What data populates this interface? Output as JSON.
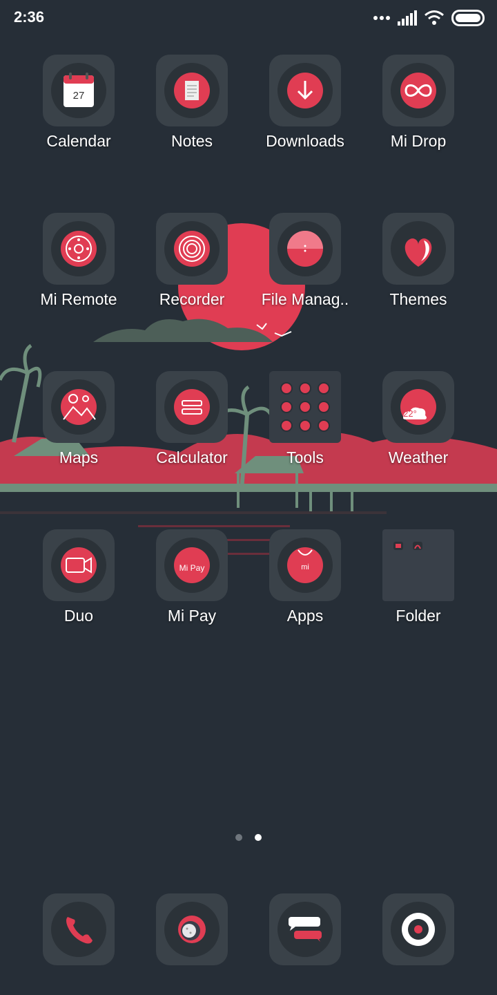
{
  "status_bar": {
    "time": "2:36"
  },
  "apps": [
    {
      "label": "Calendar",
      "icon": "calendar-icon",
      "calendar_day": "27"
    },
    {
      "label": "Notes",
      "icon": "notes-icon"
    },
    {
      "label": "Downloads",
      "icon": "download-icon"
    },
    {
      "label": "Mi Drop",
      "icon": "infinity-icon"
    },
    {
      "label": "Mi Remote",
      "icon": "remote-icon"
    },
    {
      "label": "Recorder",
      "icon": "record-icon"
    },
    {
      "label": "File Manag..",
      "icon": "folder-icon"
    },
    {
      "label": "Themes",
      "icon": "themes-icon"
    },
    {
      "label": "Maps",
      "icon": "map-icon"
    },
    {
      "label": "Calculator",
      "icon": "calculator-icon"
    },
    {
      "label": "Tools",
      "icon": "tools-folder-icon"
    },
    {
      "label": "Weather",
      "icon": "weather-icon",
      "temperature": "22°"
    },
    {
      "label": "Duo",
      "icon": "video-camera-icon"
    },
    {
      "label": "Mi Pay",
      "icon": "mi-pay-icon",
      "logo_text": "Mi Pay"
    },
    {
      "label": "Apps",
      "icon": "store-bag-icon",
      "logo_text": "mi"
    },
    {
      "label": "Folder",
      "icon": "folder-grid-icon"
    }
  ],
  "pager": {
    "pages": 2,
    "current": 2
  },
  "dock": [
    {
      "icon": "phone-icon"
    },
    {
      "icon": "browser-icon"
    },
    {
      "icon": "messages-icon"
    },
    {
      "icon": "camera-icon"
    }
  ],
  "colors": {
    "background": "#262e37",
    "accent": "#e03d53",
    "tile": "#3a4249",
    "text": "#ffffff",
    "scenery_green": "#6f8f7c"
  }
}
